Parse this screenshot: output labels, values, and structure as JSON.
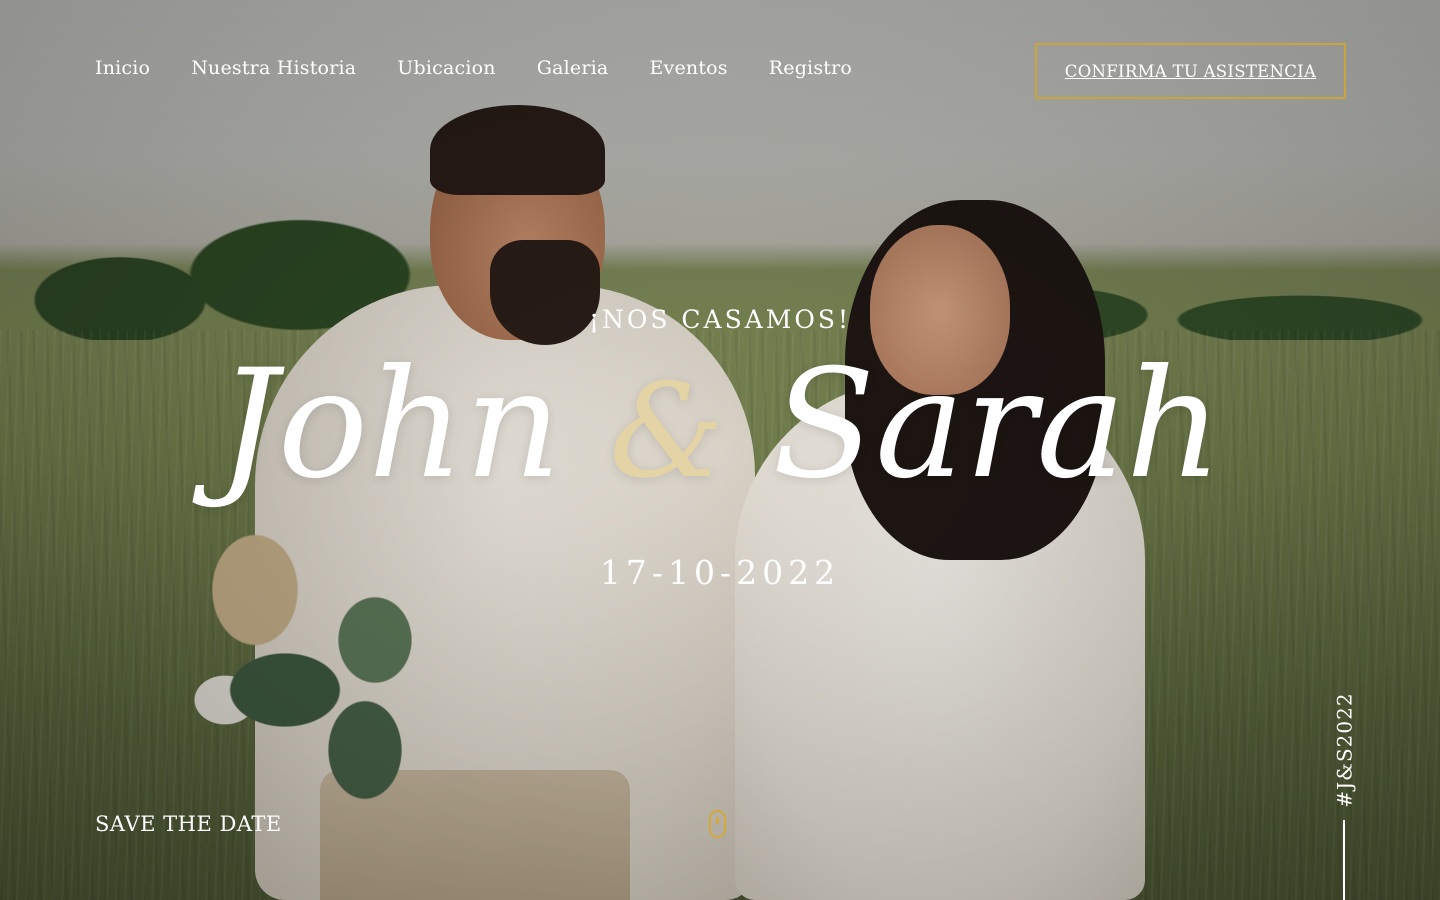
{
  "nav": {
    "links": [
      "Inicio",
      "Nuestra Historia",
      "Ubicacion",
      "Galeria",
      "Eventos",
      "Registro"
    ],
    "rsvp_label": "CONFIRMA TU ASISTENCIA"
  },
  "hero": {
    "kicker": "¡NOS CASAMOS!",
    "name_one": "John",
    "ampersand": "&",
    "name_two": "Sarah",
    "date": "17-10-2022",
    "save_the_date": "SAVE THE DATE",
    "hashtag": "#J&S2022"
  },
  "icons": {
    "scroll": "mouse-scroll-icon"
  },
  "colors": {
    "accent_gold": "#c9a53f",
    "ampersand": "#e4d3a5",
    "text": "#ffffff"
  }
}
